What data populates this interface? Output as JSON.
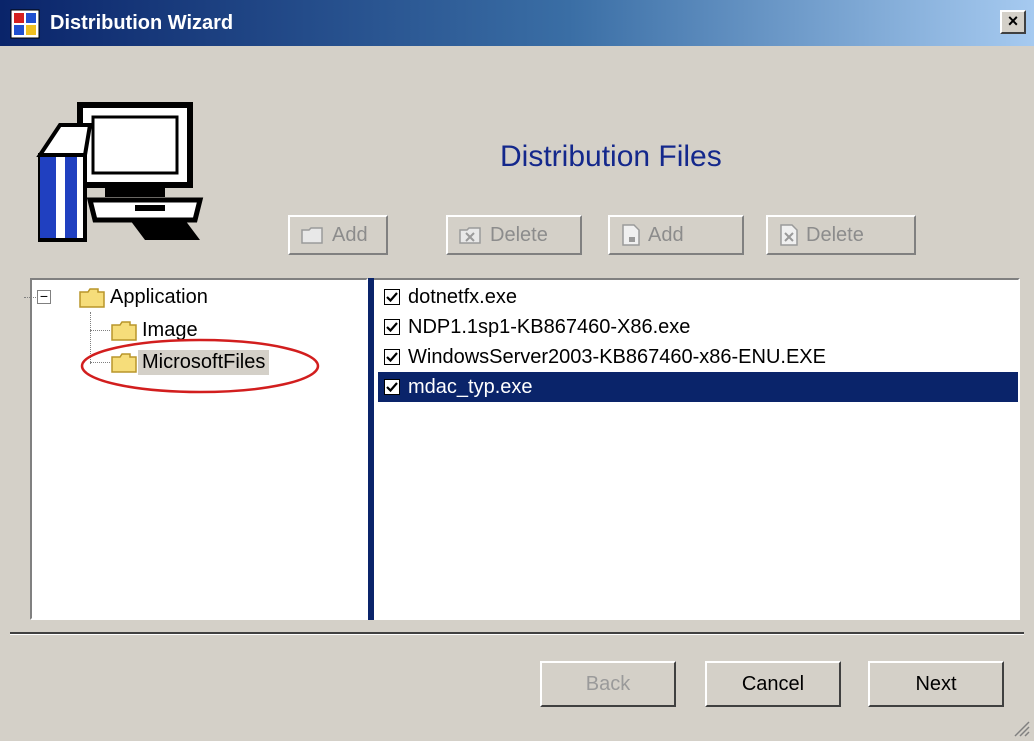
{
  "window": {
    "title": "Distribution Wizard",
    "close_label": "×"
  },
  "header": {
    "section_title": "Distribution Files"
  },
  "toolbar": {
    "buttons": [
      {
        "label": "Add",
        "icon": "folder-add-icon"
      },
      {
        "label": "Delete",
        "icon": "folder-delete-icon"
      },
      {
        "label": "Add",
        "icon": "file-add-icon"
      },
      {
        "label": "Delete",
        "icon": "file-delete-icon"
      }
    ]
  },
  "tree": {
    "expander": "−",
    "nodes": [
      {
        "label": "Application",
        "level": 0
      },
      {
        "label": "Image",
        "level": 1
      },
      {
        "label": "MicrosoftFiles",
        "level": 1,
        "selected": true
      }
    ]
  },
  "files": [
    {
      "name": "dotnetfx.exe",
      "checked": true,
      "selected": false
    },
    {
      "name": "NDP1.1sp1-KB867460-X86.exe",
      "checked": true,
      "selected": false
    },
    {
      "name": "WindowsServer2003-KB867460-x86-ENU.EXE",
      "checked": true,
      "selected": false
    },
    {
      "name": "mdac_typ.exe",
      "checked": true,
      "selected": true
    }
  ],
  "footer": {
    "back_label": "Back",
    "cancel_label": "Cancel",
    "next_label": "Next"
  },
  "colors": {
    "title_bar": "#0a246a",
    "selection": "#0a246a",
    "section_title": "#14288c",
    "annotation": "#d21e1e"
  }
}
